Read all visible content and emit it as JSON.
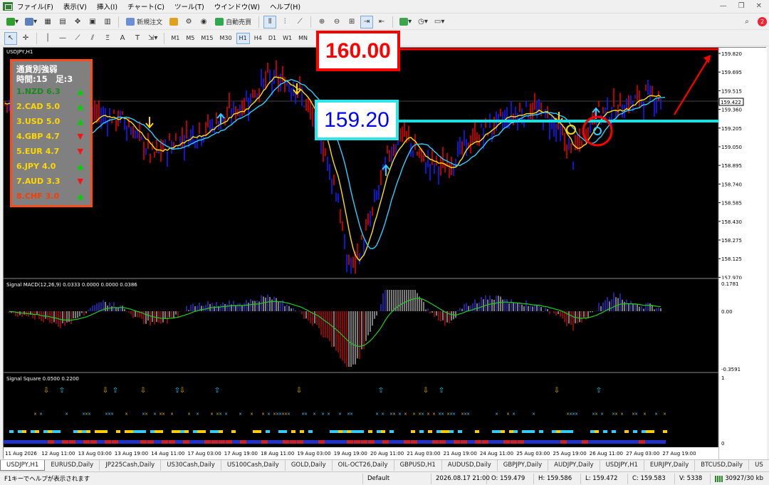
{
  "menu": {
    "items": [
      "ファイル(F)",
      "表示(V)",
      "挿入(I)",
      "チャート(C)",
      "ツール(T)",
      "ウインドウ(W)",
      "ヘルプ(H)"
    ]
  },
  "toolbar": {
    "new_order_label": "新規注文",
    "auto_trade_label": "自動売買",
    "timeframes": [
      "M1",
      "M5",
      "M15",
      "M30",
      "H1",
      "H4",
      "D1",
      "W1",
      "MN"
    ],
    "notify_badge": "2"
  },
  "chart": {
    "symbol_title": "USDJPY,H1",
    "price_axis": [
      "159.820",
      "159.695",
      "159.515",
      "159.360",
      "159.205",
      "159.050",
      "158.895",
      "158.740",
      "158.585",
      "158.430",
      "158.275",
      "158.125",
      "157.970"
    ],
    "current_price": "159.422",
    "callout_160": "160.00",
    "callout_159": "159.20",
    "colors": {
      "bull": "#1a1aff",
      "bear": "#e60000",
      "ma_fast": "#ffe000",
      "ma_slow": "#33ccff",
      "resistance": "#ff0000",
      "support": "#22dddd"
    }
  },
  "strength_panel": {
    "title": "通貨別強弱",
    "subtitle": "時間:15　足:3",
    "rows": [
      {
        "label": "1.NZD",
        "value": "6.3",
        "dir": "▲",
        "cls": "c-nzd",
        "dircls": "up"
      },
      {
        "label": "2.CAD",
        "value": "5.0",
        "dir": "▲",
        "cls": "c-cad",
        "dircls": "up"
      },
      {
        "label": "3.USD",
        "value": "5.0",
        "dir": "▲",
        "cls": "c-usd",
        "dircls": "up"
      },
      {
        "label": "4.GBP",
        "value": "4.7",
        "dir": "▼",
        "cls": "c-gbp",
        "dircls": "dn"
      },
      {
        "label": "5.EUR",
        "value": "4.7",
        "dir": "▼",
        "cls": "c-eur",
        "dircls": "dn"
      },
      {
        "label": "6.JPY",
        "value": "4.0",
        "dir": "▲",
        "cls": "c-jpy",
        "dircls": "up"
      },
      {
        "label": "7.AUD",
        "value": "3.3",
        "dir": "▼",
        "cls": "c-aud",
        "dircls": "dn"
      },
      {
        "label": "8.CHF",
        "value": "3.0",
        "dir": "▲",
        "cls": "c-chf",
        "dircls": "up"
      }
    ]
  },
  "macd": {
    "title": "Signal MACD(12,26,9) 0.0333 0.0000 0.0000 0.0386",
    "axis": [
      "0.1781",
      "0.00",
      "-0.3591"
    ]
  },
  "signal_square": {
    "title": "Signal Square 0.0500 0.2200",
    "axis": [
      "1",
      "0"
    ]
  },
  "time_axis": [
    "11 Aug 2026",
    "12 Aug 11:00",
    "13 Aug 03:00",
    "13 Aug 19:00",
    "14 Aug 11:00",
    "17 Aug 03:00",
    "17 Aug 19:00",
    "18 Aug 11:00",
    "19 Aug 03:00",
    "19 Aug 19:00",
    "20 Aug 11:00",
    "21 Aug 03:00",
    "21 Aug 19:00",
    "24 Aug 11:00",
    "25 Aug 03:00",
    "25 Aug 19:00",
    "26 Aug 11:00",
    "27 Aug 03:00",
    "27 Aug 19:00"
  ],
  "tabs": [
    "USDJPY,H1",
    "EURUSD,Daily",
    "JP225Cash,Daily",
    "US30Cash,Daily",
    "US100Cash,Daily",
    "GOLD,Daily",
    "OIL-OCT26,Daily",
    "GBPUSD,H1",
    "AUDUSD,Daily",
    "GBPJPY,Daily",
    "AUDJPY,Daily",
    "USDJPY,H1",
    "EURJPY,Daily",
    "BTCUSD,Daily",
    "US"
  ],
  "status": {
    "help": "F1キーでヘルプが表示されます",
    "profile": "Default",
    "datetime": "2026.08.17 21:00",
    "open": "O: 159.479",
    "high": "H: 159.586",
    "low": "L: 159.472",
    "close": "C: 159.583",
    "volume": "V: 5338",
    "traffic": "30927/30 kb"
  }
}
